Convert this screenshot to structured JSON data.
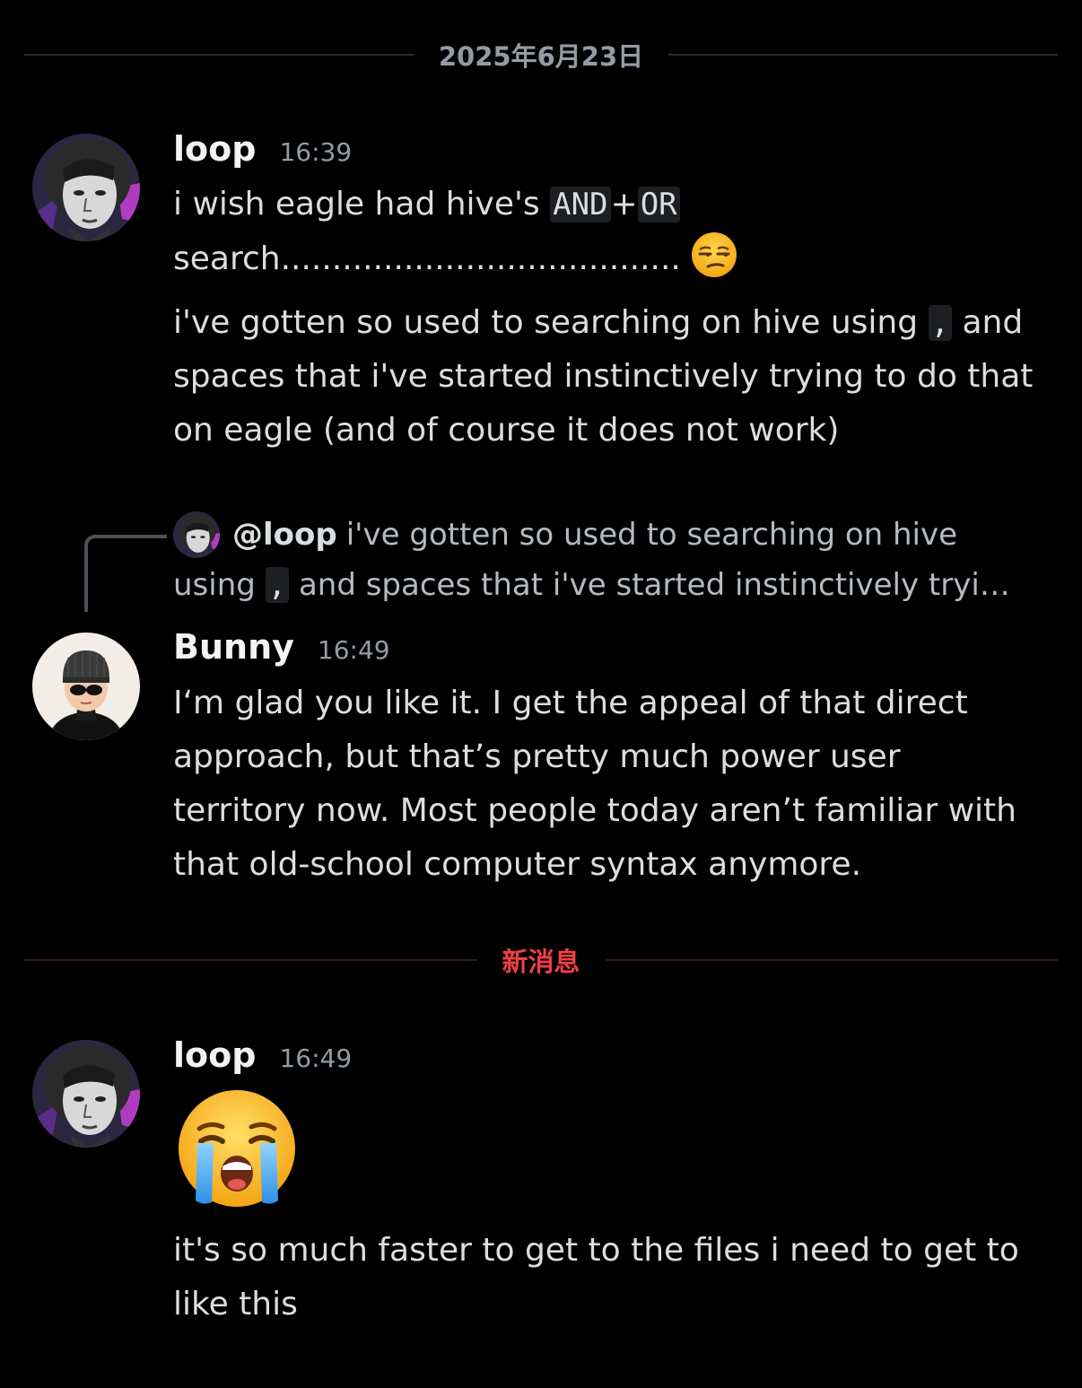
{
  "date_divider": "2025年6月23日",
  "new_messages_divider": "新消息",
  "messages": [
    {
      "author": "loop",
      "time": "16:39",
      "line1_before": "i wish eagle had hive's ",
      "code1": "AND",
      "line1_plus": "+",
      "code2": "OR",
      "line2": "search.......................................",
      "inline_emoji": "unamused-face-emoji",
      "para2_before": "i've gotten so used to searching on hive using ",
      "para2_code": ",",
      "para2_after": " and spaces that i've started instinctively trying to do that on eagle (and of course it does not work)"
    },
    {
      "author": "Bunny",
      "time": "16:49",
      "reply_mention": "@loop",
      "reply_before": "i've gotten so used to searching on hive using ",
      "reply_code": ",",
      "reply_after": " and spaces that i've started instinctively tryi…",
      "text": "I‘m glad you like it. I get the appeal of that direct approach, but that’s pretty much power user territory now. Most people today aren’t familiar with that old-school computer syntax anymore."
    },
    {
      "author": "loop",
      "time": "16:49",
      "big_emoji": "loudly-crying-face-emoji",
      "text": "it's so much faster to get to the files i need to get to like this"
    }
  ],
  "colors": {
    "background": "#000000",
    "divider_line": "#2b2d31",
    "new_divider": "#f23f43",
    "text": "#dbdee1",
    "muted": "#949ba4"
  }
}
